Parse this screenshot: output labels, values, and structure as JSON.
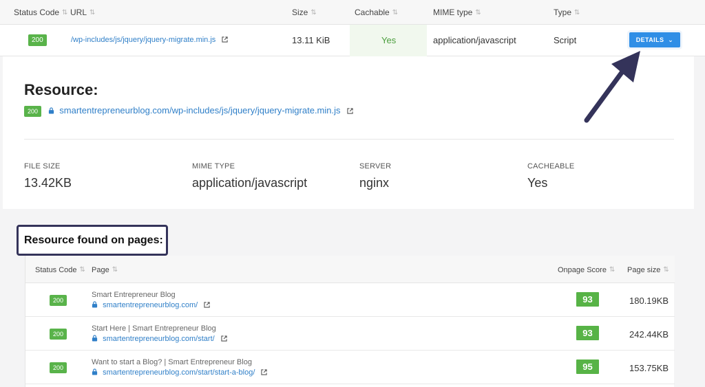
{
  "top_table": {
    "headers": [
      "Status Code",
      "URL",
      "Size",
      "Cachable",
      "MIME type",
      "Type"
    ],
    "row": {
      "status": "200",
      "url": "/wp-includes/js/jquery/jquery-migrate.min.js",
      "size": "13.11 KiB",
      "cachable": "Yes",
      "mime": "application/javascript",
      "type": "Script",
      "details_label": "DETAILS"
    }
  },
  "resource": {
    "title": "Resource:",
    "status": "200",
    "url": "smartentrepreneurblog.com/wp-includes/js/jquery/jquery-migrate.min.js",
    "stats": [
      {
        "label": "FILE SIZE",
        "value": "13.42KB"
      },
      {
        "label": "MIME TYPE",
        "value": "application/javascript"
      },
      {
        "label": "SERVER",
        "value": "nginx"
      },
      {
        "label": "CACHEABLE",
        "value": "Yes"
      }
    ]
  },
  "found": {
    "title": "Resource found on pages:",
    "headers": [
      "Status Code",
      "Page",
      "Onpage Score",
      "Page size"
    ],
    "rows": [
      {
        "status": "200",
        "title": "Smart Entrepreneur Blog",
        "url": "smartentrepreneurblog.com/",
        "score": "93",
        "size": "180.19KB"
      },
      {
        "status": "200",
        "title": "Start Here | Smart Entrepreneur Blog",
        "url": "smartentrepreneurblog.com/start/",
        "score": "93",
        "size": "242.44KB"
      },
      {
        "status": "200",
        "title": "Want to start a Blog? | Smart Entrepreneur Blog",
        "url": "smartentrepreneurblog.com/start/start-a-blog/",
        "score": "95",
        "size": "153.75KB"
      }
    ]
  },
  "colors": {
    "accent": "#2f8ee6",
    "success": "#59b34a",
    "link": "#2f7fc8",
    "annotation": "#34335a"
  }
}
